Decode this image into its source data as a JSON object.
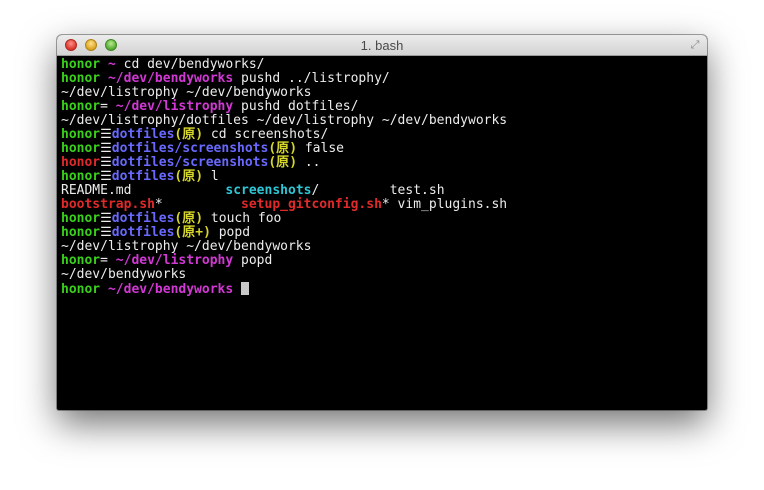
{
  "window": {
    "title": "1. bash"
  },
  "colors": {
    "green": "#39d11b",
    "magenta": "#d138d4",
    "blue": "#6969ff",
    "yellow": "#d7d729",
    "cyan": "#2fc6d6",
    "red": "#e02a2a",
    "white": "#ececec"
  },
  "terminal": {
    "lines": [
      [
        {
          "t": "honor",
          "c": "green",
          "b": true
        },
        {
          "t": " ~ ",
          "c": "magenta",
          "b": true
        },
        {
          "t": "cd dev/bendyworks/",
          "c": "white"
        }
      ],
      [
        {
          "t": "honor",
          "c": "green",
          "b": true
        },
        {
          "t": " ~/dev/bendyworks",
          "c": "magenta",
          "b": true
        },
        {
          "t": " pushd ../listrophy/",
          "c": "white"
        }
      ],
      [
        {
          "t": "~/dev/listrophy ~/dev/bendyworks",
          "c": "white"
        }
      ],
      [
        {
          "t": "honor",
          "c": "green",
          "b": true
        },
        {
          "t": "= ",
          "c": "white"
        },
        {
          "t": "~/dev/listrophy",
          "c": "magenta",
          "b": true
        },
        {
          "t": " pushd dotfiles/",
          "c": "white"
        }
      ],
      [
        {
          "t": "~/dev/listrophy/dotfiles ~/dev/listrophy ~/dev/bendyworks",
          "c": "white"
        }
      ],
      [
        {
          "t": "honor",
          "c": "green",
          "b": true
        },
        {
          "t": "☰",
          "c": "white"
        },
        {
          "t": "dotfiles",
          "c": "blue",
          "b": true
        },
        {
          "t": "(",
          "c": "yellow",
          "b": true
        },
        {
          "t": "原",
          "c": "yellow",
          "b": true
        },
        {
          "t": ")",
          "c": "yellow",
          "b": true
        },
        {
          "t": " cd screenshots/",
          "c": "white"
        }
      ],
      [
        {
          "t": "honor",
          "c": "green",
          "b": true
        },
        {
          "t": "☰",
          "c": "white"
        },
        {
          "t": "dotfiles/screenshots",
          "c": "blue",
          "b": true
        },
        {
          "t": "(",
          "c": "yellow",
          "b": true
        },
        {
          "t": "原",
          "c": "yellow",
          "b": true
        },
        {
          "t": ")",
          "c": "yellow",
          "b": true
        },
        {
          "t": " false",
          "c": "white"
        }
      ],
      [
        {
          "t": "honor",
          "c": "red",
          "b": true
        },
        {
          "t": "☰",
          "c": "white"
        },
        {
          "t": "dotfiles/screenshots",
          "c": "blue",
          "b": true
        },
        {
          "t": "(",
          "c": "yellow",
          "b": true
        },
        {
          "t": "原",
          "c": "yellow",
          "b": true
        },
        {
          "t": ")",
          "c": "yellow",
          "b": true
        },
        {
          "t": " ..",
          "c": "white"
        }
      ],
      [
        {
          "t": "honor",
          "c": "green",
          "b": true
        },
        {
          "t": "☰",
          "c": "white"
        },
        {
          "t": "dotfiles",
          "c": "blue",
          "b": true
        },
        {
          "t": "(",
          "c": "yellow",
          "b": true
        },
        {
          "t": "原",
          "c": "yellow",
          "b": true
        },
        {
          "t": ")",
          "c": "yellow",
          "b": true
        },
        {
          "t": " l",
          "c": "white"
        }
      ],
      [
        {
          "t": "README.md            ",
          "c": "white"
        },
        {
          "t": "screenshots",
          "c": "cyan",
          "b": true
        },
        {
          "t": "/         test.sh",
          "c": "white"
        }
      ],
      [
        {
          "t": "bootstrap.sh",
          "c": "red",
          "b": true
        },
        {
          "t": "*          ",
          "c": "white"
        },
        {
          "t": "setup_gitconfig.sh",
          "c": "red",
          "b": true
        },
        {
          "t": "* vim_plugins.sh",
          "c": "white"
        }
      ],
      [
        {
          "t": "honor",
          "c": "green",
          "b": true
        },
        {
          "t": "☰",
          "c": "white"
        },
        {
          "t": "dotfiles",
          "c": "blue",
          "b": true
        },
        {
          "t": "(",
          "c": "yellow",
          "b": true
        },
        {
          "t": "原",
          "c": "yellow",
          "b": true
        },
        {
          "t": ")",
          "c": "yellow",
          "b": true
        },
        {
          "t": " touch foo",
          "c": "white"
        }
      ],
      [
        {
          "t": "honor",
          "c": "green",
          "b": true
        },
        {
          "t": "☰",
          "c": "white"
        },
        {
          "t": "dotfiles",
          "c": "blue",
          "b": true
        },
        {
          "t": "(",
          "c": "yellow",
          "b": true
        },
        {
          "t": "原+",
          "c": "yellow",
          "b": true
        },
        {
          "t": ")",
          "c": "yellow",
          "b": true
        },
        {
          "t": " popd",
          "c": "white"
        }
      ],
      [
        {
          "t": "~/dev/listrophy ~/dev/bendyworks",
          "c": "white"
        }
      ],
      [
        {
          "t": "honor",
          "c": "green",
          "b": true
        },
        {
          "t": "= ",
          "c": "white"
        },
        {
          "t": "~/dev/listrophy",
          "c": "magenta",
          "b": true
        },
        {
          "t": " popd",
          "c": "white"
        }
      ],
      [
        {
          "t": "~/dev/bendyworks",
          "c": "white"
        }
      ],
      [
        {
          "t": "honor",
          "c": "green",
          "b": true
        },
        {
          "t": " ~/dev/bendyworks",
          "c": "magenta",
          "b": true
        },
        {
          "t": " ",
          "c": "white"
        }
      ]
    ]
  }
}
